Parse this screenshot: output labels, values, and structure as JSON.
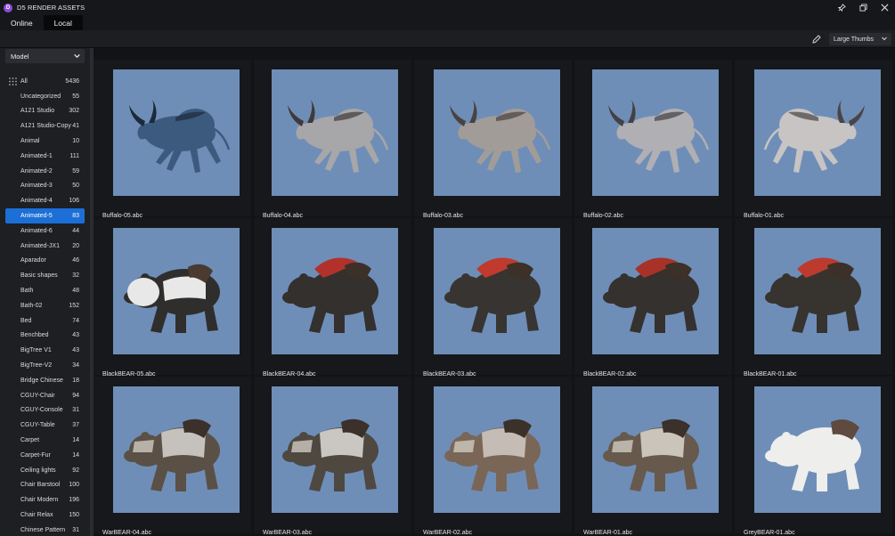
{
  "app": {
    "title": "D5 RENDER ASSETS",
    "logo_letter": "D"
  },
  "tabs": [
    {
      "label": "Online"
    },
    {
      "label": "Local"
    }
  ],
  "toolbar": {
    "view_mode": "Large Thumbs"
  },
  "sidebar": {
    "filter_select": "Model",
    "categories": [
      {
        "label": "All",
        "count": "5436"
      },
      {
        "label": "Uncategorized",
        "count": "55"
      },
      {
        "label": "A121 Studio",
        "count": "302"
      },
      {
        "label": "A121 Studio-Copy",
        "count": "41"
      },
      {
        "label": "Animal",
        "count": "10"
      },
      {
        "label": "Animated-1",
        "count": "111"
      },
      {
        "label": "Animated-2",
        "count": "59"
      },
      {
        "label": "Animated-3",
        "count": "50"
      },
      {
        "label": "Animated-4",
        "count": "106"
      },
      {
        "label": "Animated-5",
        "count": "83"
      },
      {
        "label": "Animated-6",
        "count": "44"
      },
      {
        "label": "Animated-JX1",
        "count": "20"
      },
      {
        "label": "Aparador",
        "count": "46"
      },
      {
        "label": "Basic shapes",
        "count": "32"
      },
      {
        "label": "Bath",
        "count": "48"
      },
      {
        "label": "Bath-02",
        "count": "152"
      },
      {
        "label": "Bed",
        "count": "74"
      },
      {
        "label": "Benchbed",
        "count": "43"
      },
      {
        "label": "BigTree V1",
        "count": "43"
      },
      {
        "label": "BigTree-V2",
        "count": "34"
      },
      {
        "label": "Bridge Chinese",
        "count": "18"
      },
      {
        "label": "CGUY-Chair",
        "count": "94"
      },
      {
        "label": "CGUY-Console",
        "count": "31"
      },
      {
        "label": "CGUY-Table",
        "count": "37"
      },
      {
        "label": "Carpet",
        "count": "14"
      },
      {
        "label": "Carpet-Fur",
        "count": "14"
      },
      {
        "label": "Ceiling lights",
        "count": "92"
      },
      {
        "label": "Chair Barstool",
        "count": "100"
      },
      {
        "label": "Chair Modern",
        "count": "196"
      },
      {
        "label": "Chair Relax",
        "count": "150"
      },
      {
        "label": "Chinese Pattern",
        "count": "31"
      }
    ],
    "selected_index": 9
  },
  "assets": [
    {
      "name": "Buffalo-05.abc",
      "kind": "buffalo",
      "body_color": "#3c5a7d",
      "accent": "#1c2a3a"
    },
    {
      "name": "Buffalo-04.abc",
      "kind": "buffalo",
      "body_color": "#a7a6a8",
      "accent": "#3f3a3a"
    },
    {
      "name": "Buffalo-03.abc",
      "kind": "buffalo",
      "body_color": "#a29c98",
      "accent": "#4a4240"
    },
    {
      "name": "Buffalo-02.abc",
      "kind": "buffalo",
      "body_color": "#b0afb3",
      "accent": "#444044"
    },
    {
      "name": "Buffalo-01.abc",
      "kind": "buffalo",
      "body_color": "#c7c4c3",
      "accent": "#4a4545"
    },
    {
      "name": "BlackBEAR-05.abc",
      "kind": "panda",
      "body_color": "#2f2e2d",
      "accent": "#e8e8e8"
    },
    {
      "name": "BlackBEAR-04.abc",
      "kind": "bear",
      "body_color": "#33302d",
      "accent": "#b2322b"
    },
    {
      "name": "BlackBEAR-03.abc",
      "kind": "bear",
      "body_color": "#383431",
      "accent": "#c03a2e"
    },
    {
      "name": "BlackBEAR-02.abc",
      "kind": "bear",
      "body_color": "#35312e",
      "accent": "#a83128"
    },
    {
      "name": "BlackBEAR-01.abc",
      "kind": "bear",
      "body_color": "#37332f",
      "accent": "#bd3a2f"
    },
    {
      "name": "WarBEAR-04.abc",
      "kind": "warbear",
      "body_color": "#5b5046",
      "accent": "#d8d6d2"
    },
    {
      "name": "WarBEAR-03.abc",
      "kind": "warbear",
      "body_color": "#4e4841",
      "accent": "#e0ddd8"
    },
    {
      "name": "WarBEAR-02.abc",
      "kind": "warbear",
      "body_color": "#7a6656",
      "accent": "#d2cdc6"
    },
    {
      "name": "WarBEAR-01.abc",
      "kind": "warbear",
      "body_color": "#675a4c",
      "accent": "#ddd7cf"
    },
    {
      "name": "GreyBEAR-01.abc",
      "kind": "polar",
      "body_color": "#eeeeec",
      "accent": "#5e4a3e"
    }
  ]
}
